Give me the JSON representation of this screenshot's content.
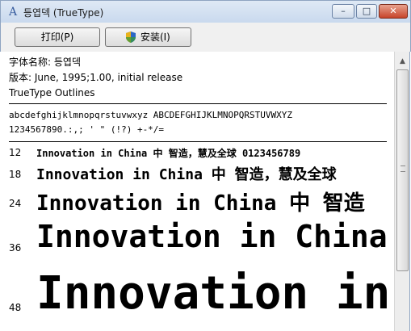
{
  "window": {
    "title": "등엽덱 (TrueType)",
    "minimize": "–",
    "maximize": "□",
    "close": "✕"
  },
  "toolbar": {
    "print_label": "打印(P)",
    "install_label": "安装(I)",
    "install_icon": "shield-icon"
  },
  "info": {
    "font_name": "字体名称: 등엽덱",
    "version": "版本: June, 1995;1.00, initial release",
    "type": "TrueType Outlines"
  },
  "charset": {
    "line1": "abcdefghijklmnopqrstuvwxyz ABCDEFGHIJKLMNOPQRSTUVWXYZ",
    "line2": "1234567890.:,; ' \" (!?) +-*/="
  },
  "samples": [
    {
      "size": "12",
      "text": "Innovation in China 中  智造，慧及全球 0123456789"
    },
    {
      "size": "18",
      "text": "Innovation in China 中  智造，慧及全球"
    },
    {
      "size": "24",
      "text": "Innovation in China 中  智造"
    },
    {
      "size": "36",
      "text": "Innovation in China"
    },
    {
      "size": "48",
      "text": "Innovation in"
    }
  ]
}
